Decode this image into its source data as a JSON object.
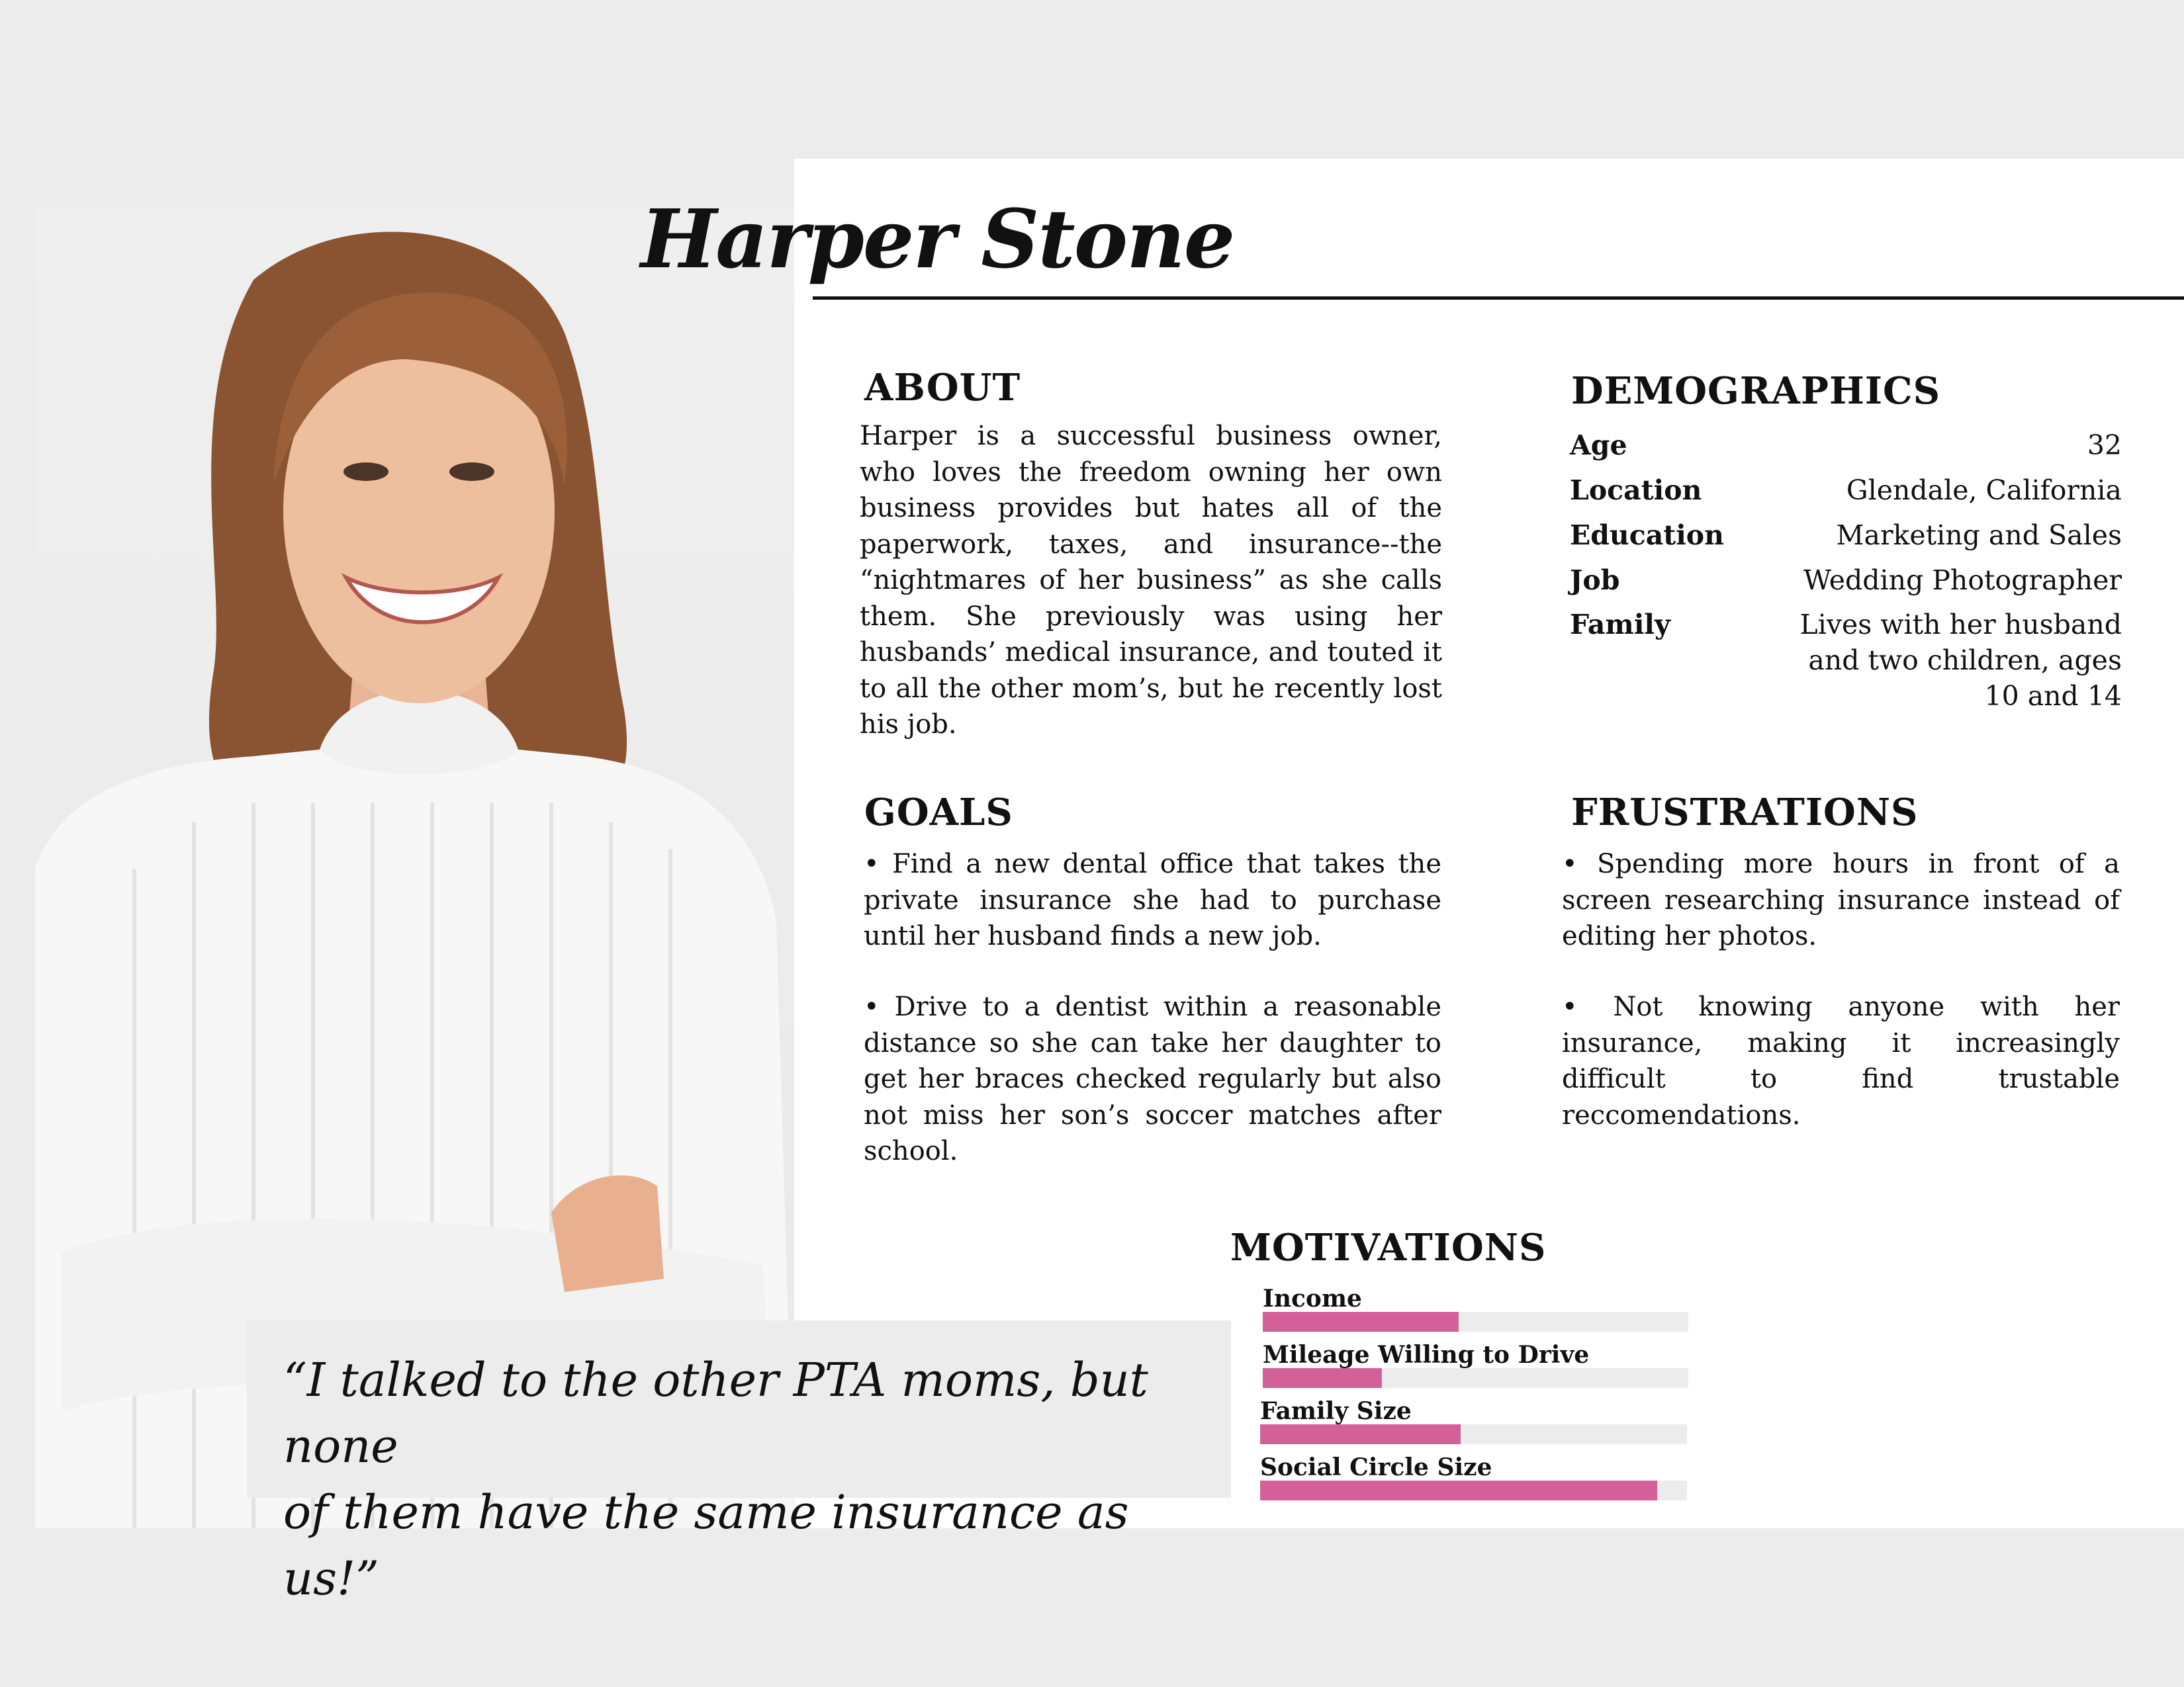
{
  "persona": {
    "name": "Harper Stone"
  },
  "about": {
    "title": "ABOUT",
    "text": "Harper is a successful business owner, who loves the freedom owning her own business provides but hates all of the paperwork, taxes, and insurance--the “nightmares of her business” as she calls them. She previously was using her husbands’ medical insurance, and touted it to all the other mom’s, but he recently lost his job."
  },
  "demographics": {
    "title": "DEMOGRAPHICS",
    "rows": [
      {
        "label": "Age",
        "value": "32"
      },
      {
        "label": "Location",
        "value": "Glendale, California"
      },
      {
        "label": "Education",
        "value": "Marketing and Sales"
      },
      {
        "label": "Job",
        "value": "Wedding Photographer"
      },
      {
        "label": "Family",
        "value": "Lives with her husband and two children, ages 10 and 14"
      }
    ]
  },
  "goals": {
    "title": "GOALS",
    "items": [
      "• Find a new dental office that takes the private insurance she had to purchase until her husband finds a new job.",
      "• Drive to a dentist within a reasonable distance so she can take her daughter to get her braces checked regularly but also not miss her son’s soccer matches after school."
    ]
  },
  "frustrations": {
    "title": "FRUSTRATIONS",
    "items": [
      "• Spending more hours in front of a screen researching insurance instead of editing her photos.",
      "• Not knowing anyone with her insurance, making it increasingly difficult to find trustable reccomendations."
    ]
  },
  "quote": {
    "line1": "“I talked to the other PTA moms, but none",
    "line2": "of them have the same insurance as us!”"
  },
  "motivations": {
    "title": "MOTIVATIONS",
    "accent_color": "#d4609a",
    "track_color": "#ececec",
    "items": [
      {
        "label": "Income",
        "level": 0.46
      },
      {
        "label": "Mileage Willing to Drive",
        "level": 0.28
      },
      {
        "label": "Family Size",
        "level": 0.47
      },
      {
        "label": "Social Circle Size",
        "level": 0.93
      }
    ]
  }
}
